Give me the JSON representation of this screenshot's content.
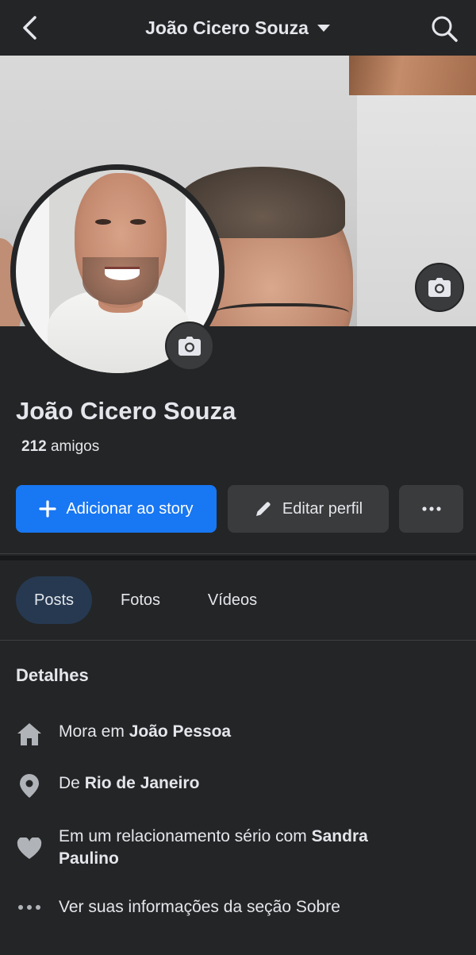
{
  "header": {
    "title": "João Cicero Souza",
    "back_icon": "chevron-left-icon",
    "dropdown_icon": "caret-down-icon",
    "search_icon": "search-icon"
  },
  "profile": {
    "name": "João Cicero Souza",
    "friends_count": "212",
    "friends_label": "amigos"
  },
  "actions": {
    "add_story": "Adicionar ao story",
    "edit_profile": "Editar perfil",
    "more_icon": "more-dots-icon"
  },
  "tabs": [
    {
      "label": "Posts",
      "active": true
    },
    {
      "label": "Fotos",
      "active": false
    },
    {
      "label": "Vídeos",
      "active": false
    }
  ],
  "details": {
    "title": "Detalhes",
    "lives_prefix": "Mora em ",
    "lives_value": "João Pessoa",
    "from_prefix": "De ",
    "from_value": "Rio de Janeiro",
    "relationship_prefix": "Em um relacionamento sério com ",
    "relationship_value": "Sandra Paulino",
    "about_link": "Ver suas informações da seção Sobre"
  },
  "colors": {
    "background": "#242526",
    "primary_button": "#1877f2",
    "secondary_button": "#3a3b3c",
    "active_tab": "#263951",
    "text": "#e4e6eb"
  }
}
